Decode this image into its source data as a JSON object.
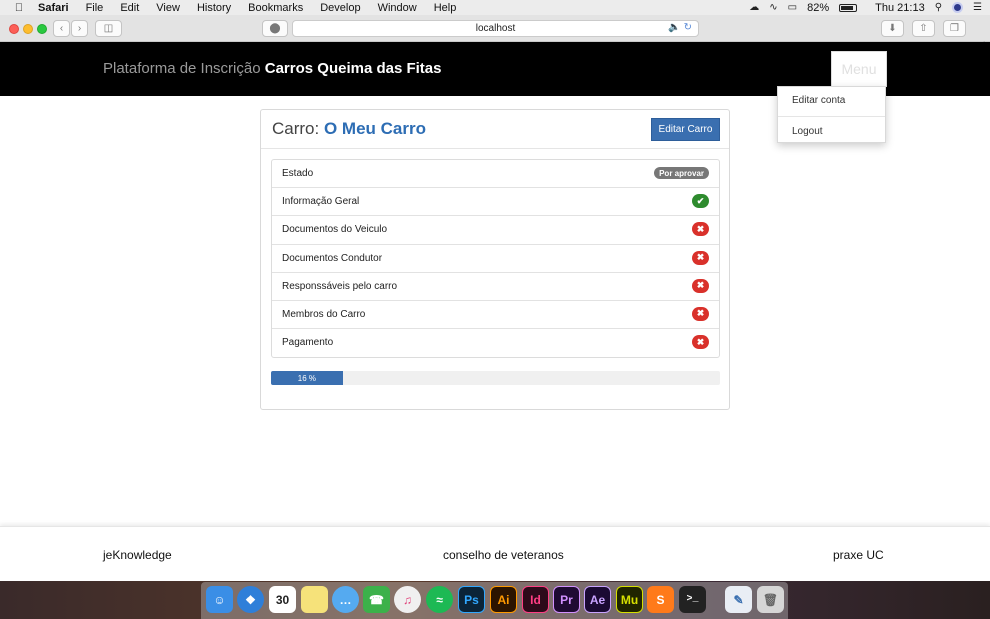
{
  "menubar": {
    "app": "Safari",
    "items": [
      "File",
      "Edit",
      "View",
      "History",
      "Bookmarks",
      "Develop",
      "Window",
      "Help"
    ],
    "battery": "82%",
    "clock": "Thu 21:13"
  },
  "browser": {
    "url": "localhost"
  },
  "navbar": {
    "brand_light": "Plataforma de Inscrição",
    "brand_bold": "Carros Queima das Fitas",
    "menu_label": "Menu",
    "dropdown": [
      "Editar conta",
      "Logout"
    ]
  },
  "card": {
    "title_prefix": "Carro:",
    "car_name": "O Meu Carro",
    "edit_button": "Editar Carro",
    "status_label": "Estado",
    "status_value": "Por aprovar",
    "items": [
      {
        "label": "Informação Geral",
        "complete": true
      },
      {
        "label": "Documentos do Veiculo",
        "complete": false
      },
      {
        "label": "Documentos Condutor",
        "complete": false
      },
      {
        "label": "Responssáveis pelo carro",
        "complete": false
      },
      {
        "label": "Membros do Carro",
        "complete": false
      },
      {
        "label": "Pagamento",
        "complete": false
      }
    ],
    "progress_label": "16 %",
    "progress_fraction": 0.16
  },
  "footer": {
    "left": "jeKnowledge",
    "center": "conselho de veteranos",
    "right": "praxe UC"
  },
  "dock": {
    "calendar_day": "30",
    "apps": [
      "finder-icon",
      "safari-icon",
      "calendar-icon",
      "notes-icon",
      "messages-icon",
      "facetime-icon",
      "itunes-icon",
      "spotify-icon",
      "photoshop-icon",
      "illustrator-icon",
      "indesign-icon",
      "premiere-icon",
      "aftereffects-icon",
      "muse-icon",
      "sublime-icon",
      "terminal-icon",
      "preview-icon",
      "trash-icon"
    ],
    "labels": {
      "ps": "Ps",
      "ai": "Ai",
      "id": "Id",
      "pr": "Pr",
      "ae": "Ae",
      "mu": "Mu"
    }
  }
}
